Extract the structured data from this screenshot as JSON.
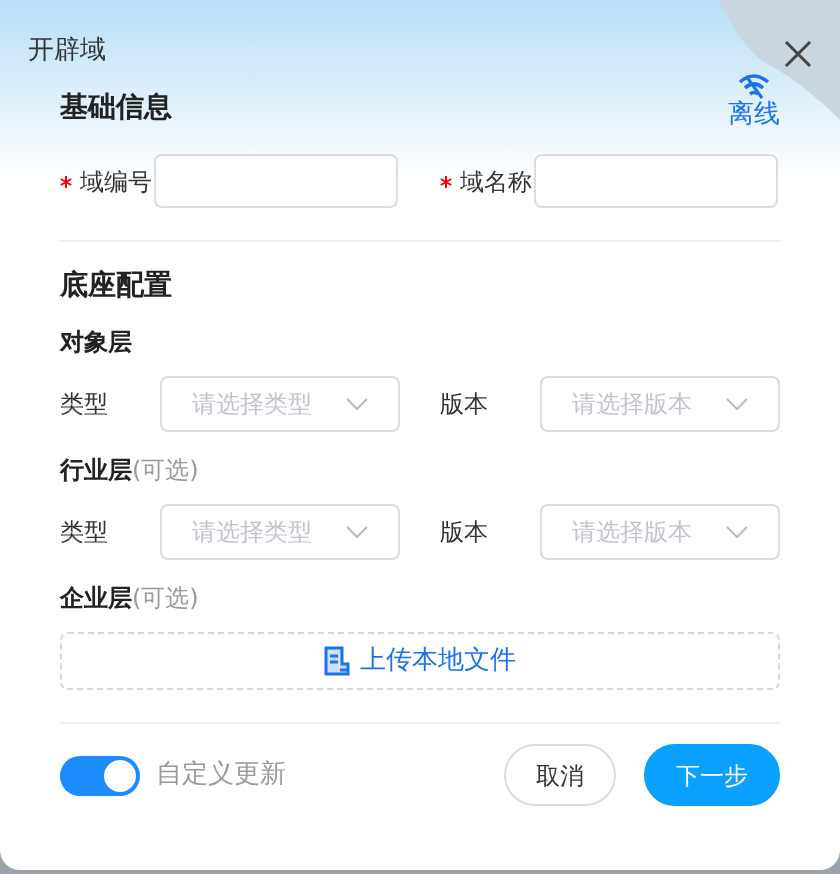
{
  "dialog": {
    "title": "开辟域",
    "status": "离线"
  },
  "basic_info": {
    "title": "基础信息",
    "fields": [
      {
        "label": "域编号",
        "required": true
      },
      {
        "label": "域名称",
        "required": true
      }
    ]
  },
  "base_config": {
    "title": "底座配置",
    "layers": [
      {
        "title": "对象层",
        "selects": [
          {
            "label": "类型",
            "placeholder": "请选择类型"
          },
          {
            "label": "版本",
            "placeholder": "请选择版本"
          }
        ]
      },
      {
        "title": "行业层",
        "note": "(可选)",
        "selects": [
          {
            "label": "类型",
            "placeholder": "请选择类型"
          },
          {
            "label": "版本",
            "placeholder": "请选择版本"
          }
        ]
      },
      {
        "title": "企业层",
        "note": "(可选)",
        "upload": "上传本地文件"
      }
    ]
  },
  "footer": {
    "toggle": {
      "label": "自定义更新",
      "on": true
    },
    "buttons": [
      {
        "label": "取消",
        "kind": "secondary"
      },
      {
        "label": "下一步",
        "kind": "primary"
      }
    ]
  }
}
